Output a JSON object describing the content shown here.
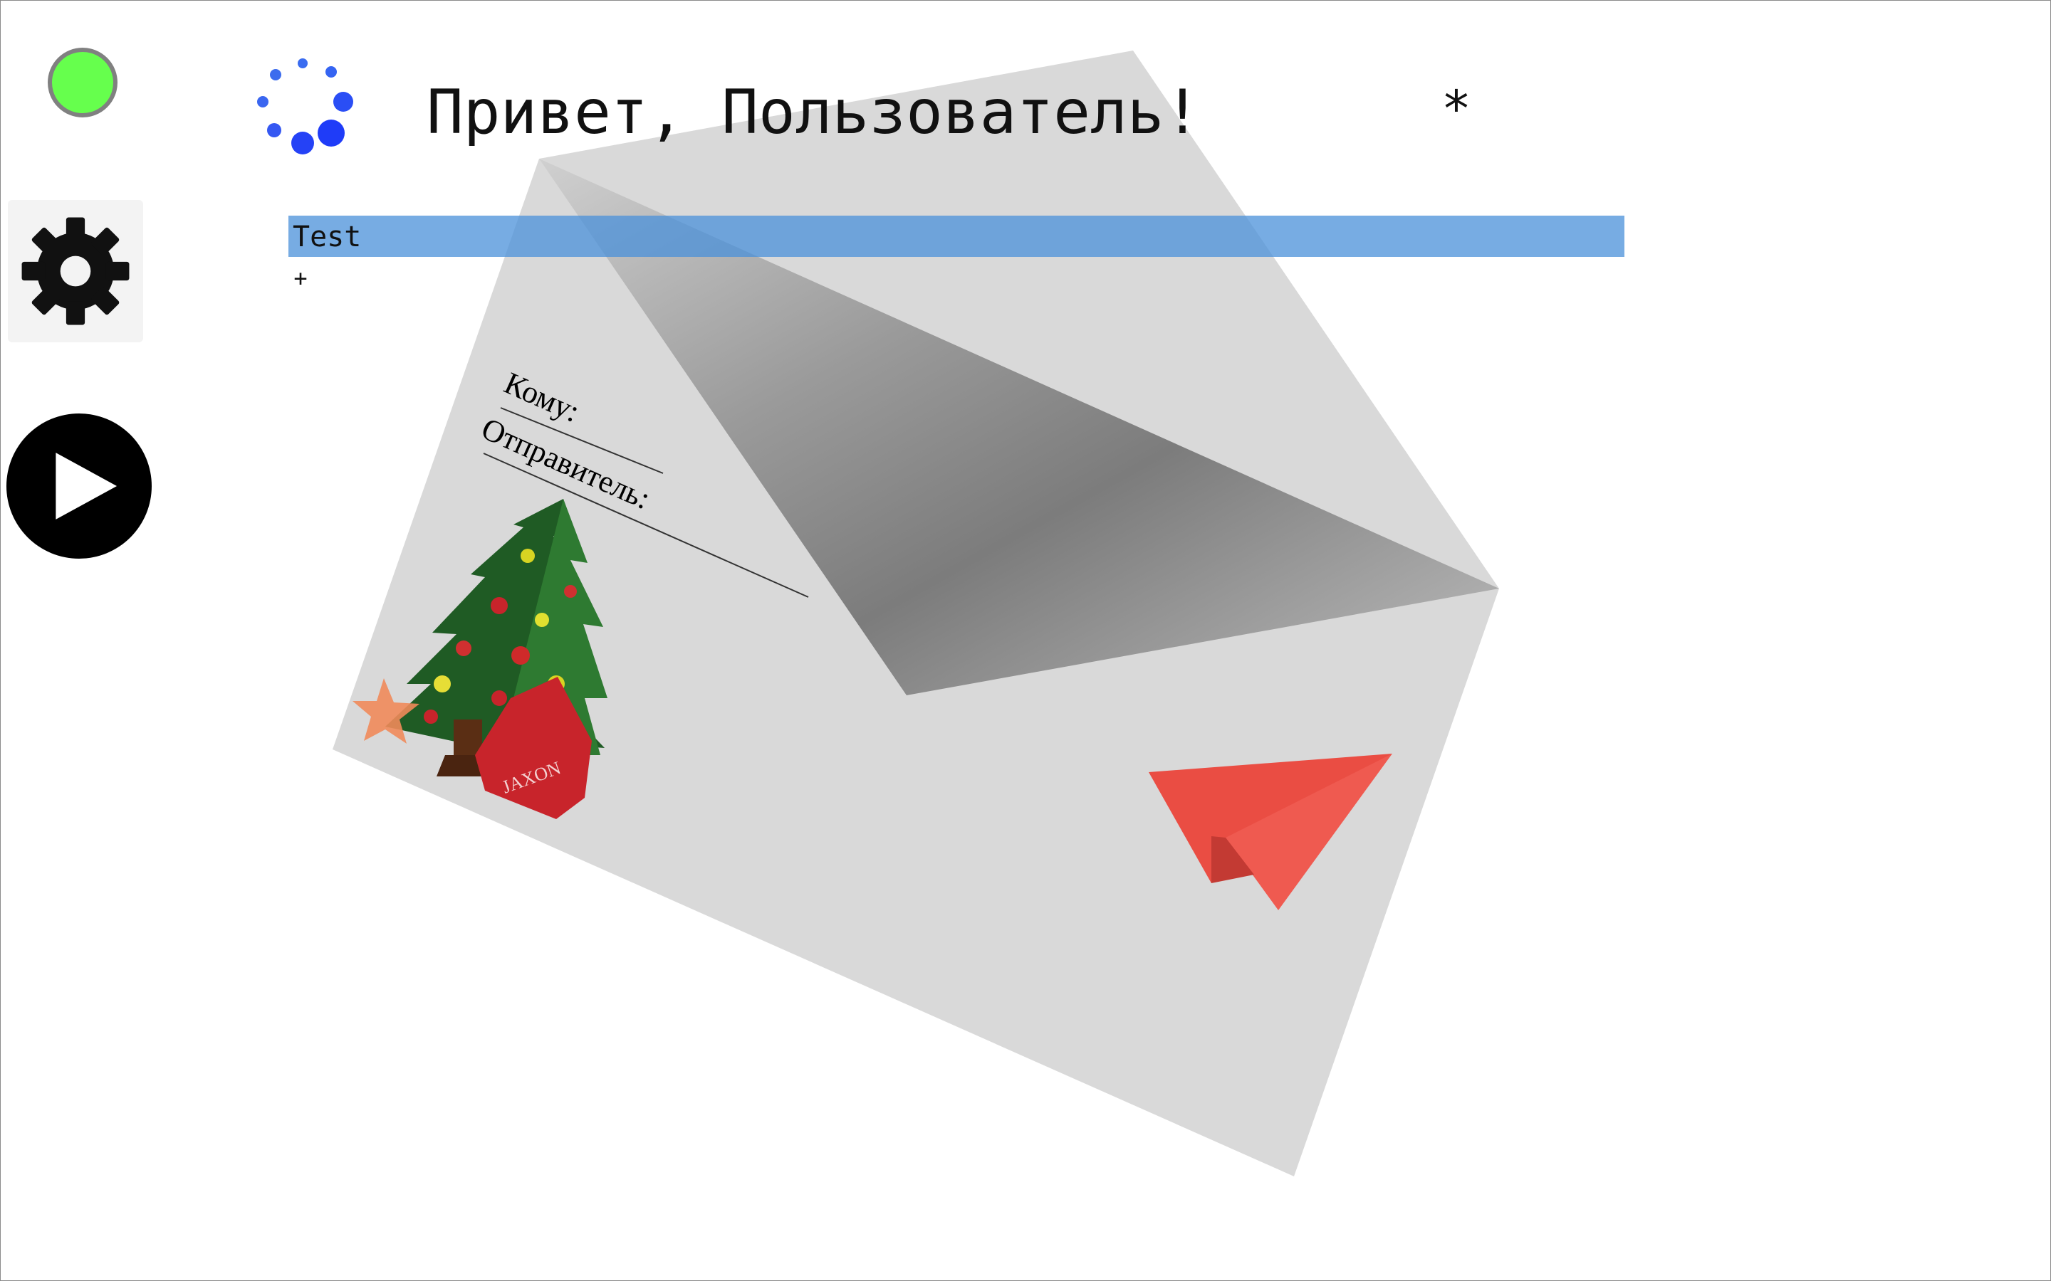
{
  "header": {
    "greeting": "Привет, Пользователь!",
    "asterisk": "*"
  },
  "sidebar": {
    "status_color": "#66ff4d",
    "settings_icon": "gear-icon",
    "play_icon": "play-icon"
  },
  "editor": {
    "line_text": "Test",
    "add_symbol": "+",
    "selection_color": "#4a90d9"
  },
  "envelope": {
    "to_label": "Кому:",
    "sender_label": "Отправитель:",
    "send_icon": "paper-plane-icon",
    "plane_color": "#ea4d43",
    "decoration": "christmas-tree-icon"
  },
  "sticker": {
    "brand_text": "JAXON"
  }
}
